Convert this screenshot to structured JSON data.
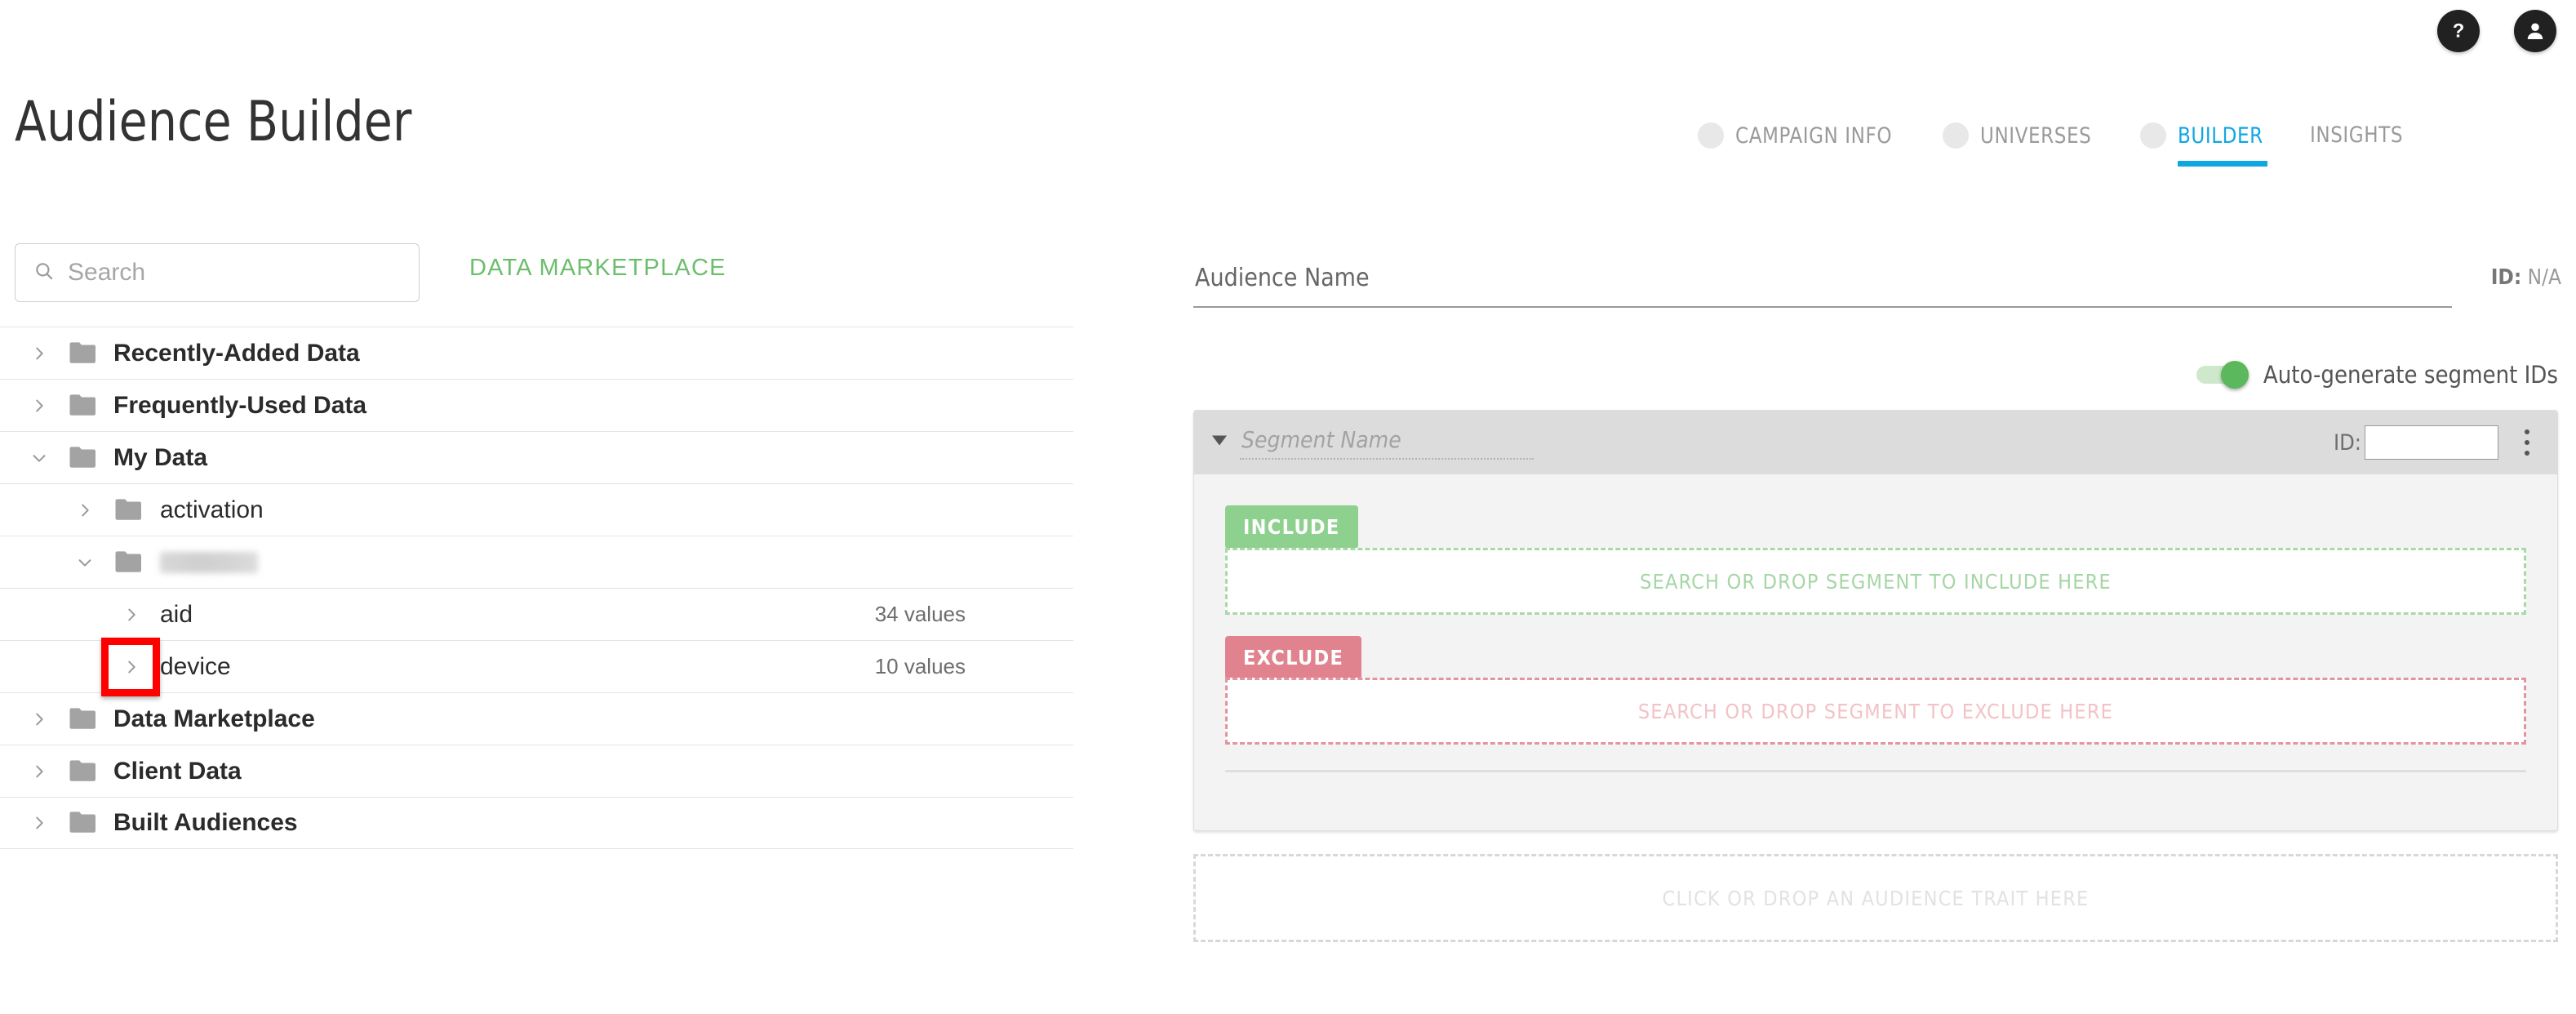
{
  "header": {
    "title": "Audience Builder",
    "help_icon": "help-circle-icon",
    "account_icon": "account-circle-icon"
  },
  "nav": {
    "tabs": [
      {
        "label": "CAMPAIGN INFO",
        "active": false,
        "has_dot": true
      },
      {
        "label": "UNIVERSES",
        "active": false,
        "has_dot": true
      },
      {
        "label": "BUILDER",
        "active": true,
        "has_dot": true
      },
      {
        "label": "INSIGHTS",
        "active": false,
        "has_dot": false
      }
    ],
    "active_color": "#0fa7e0",
    "inactive_color": "#9a9a9a"
  },
  "left_panel": {
    "search": {
      "placeholder": "Search",
      "value": "",
      "icon": "search-icon"
    },
    "marketplace_link": "DATA MARKETPLACE",
    "marketplace_link_color": "#6cbe6c",
    "tree": [
      {
        "label": "Recently-Added Data",
        "level": 0,
        "expanded": false,
        "folder": true,
        "bold": true,
        "count": ""
      },
      {
        "label": "Frequently-Used Data",
        "level": 0,
        "expanded": false,
        "folder": true,
        "bold": true,
        "count": ""
      },
      {
        "label": "My Data",
        "level": 0,
        "expanded": true,
        "folder": true,
        "bold": true,
        "count": ""
      },
      {
        "label": "activation",
        "level": 1,
        "expanded": false,
        "folder": true,
        "bold": false,
        "count": ""
      },
      {
        "label": "",
        "level": 1,
        "expanded": true,
        "folder": true,
        "bold": false,
        "count": "",
        "redacted": true
      },
      {
        "label": "aid",
        "level": 2,
        "expanded": false,
        "folder": false,
        "bold": false,
        "count": "34 values"
      },
      {
        "label": "device",
        "level": 2,
        "expanded": false,
        "folder": false,
        "bold": false,
        "count": "10 values",
        "highlighted": true
      },
      {
        "label": "Data Marketplace",
        "level": 0,
        "expanded": false,
        "folder": true,
        "bold": true,
        "count": ""
      },
      {
        "label": "Client Data",
        "level": 0,
        "expanded": false,
        "folder": true,
        "bold": true,
        "count": ""
      },
      {
        "label": "Built Audiences",
        "level": 0,
        "expanded": false,
        "folder": true,
        "bold": true,
        "count": ""
      }
    ],
    "highlight_color": "#fe0000"
  },
  "right_panel": {
    "audience_name": {
      "placeholder": "Audience Name",
      "value": ""
    },
    "audience_id_label": "ID:",
    "audience_id_value": "N/A",
    "autogenerate": {
      "label": "Auto-generate segment IDs",
      "on": true,
      "color": "#5cb85c"
    },
    "segment": {
      "name_placeholder": "Segment Name",
      "name_value": "",
      "id_label": "ID:",
      "id_value": "",
      "collapse_icon": "triangle-down-icon",
      "menu_icon": "kebab-menu-icon",
      "include": {
        "badge": "INCLUDE",
        "badge_color": "#8ed08e",
        "dropzone_text": "SEARCH OR DROP SEGMENT TO INCLUDE HERE"
      },
      "exclude": {
        "badge": "EXCLUDE",
        "badge_color": "#e0838f",
        "dropzone_text": "SEARCH OR DROP SEGMENT TO EXCLUDE HERE"
      }
    },
    "trait_dropzone_text": "CLICK OR DROP AN AUDIENCE TRAIT HERE"
  }
}
